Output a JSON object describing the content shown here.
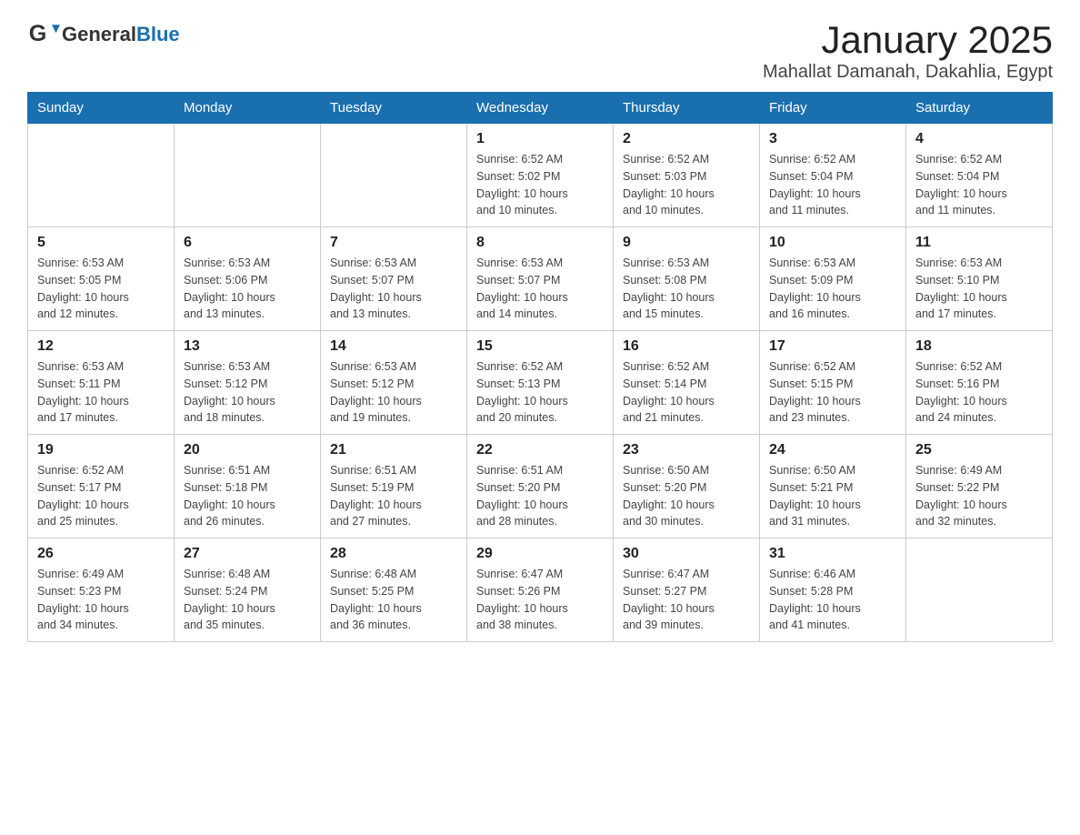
{
  "header": {
    "title": "January 2025",
    "subtitle": "Mahallat Damanah, Dakahlia, Egypt",
    "logo_general": "General",
    "logo_blue": "Blue"
  },
  "days_of_week": [
    "Sunday",
    "Monday",
    "Tuesday",
    "Wednesday",
    "Thursday",
    "Friday",
    "Saturday"
  ],
  "weeks": [
    [
      {
        "day": "",
        "info": ""
      },
      {
        "day": "",
        "info": ""
      },
      {
        "day": "",
        "info": ""
      },
      {
        "day": "1",
        "info": "Sunrise: 6:52 AM\nSunset: 5:02 PM\nDaylight: 10 hours\nand 10 minutes."
      },
      {
        "day": "2",
        "info": "Sunrise: 6:52 AM\nSunset: 5:03 PM\nDaylight: 10 hours\nand 10 minutes."
      },
      {
        "day": "3",
        "info": "Sunrise: 6:52 AM\nSunset: 5:04 PM\nDaylight: 10 hours\nand 11 minutes."
      },
      {
        "day": "4",
        "info": "Sunrise: 6:52 AM\nSunset: 5:04 PM\nDaylight: 10 hours\nand 11 minutes."
      }
    ],
    [
      {
        "day": "5",
        "info": "Sunrise: 6:53 AM\nSunset: 5:05 PM\nDaylight: 10 hours\nand 12 minutes."
      },
      {
        "day": "6",
        "info": "Sunrise: 6:53 AM\nSunset: 5:06 PM\nDaylight: 10 hours\nand 13 minutes."
      },
      {
        "day": "7",
        "info": "Sunrise: 6:53 AM\nSunset: 5:07 PM\nDaylight: 10 hours\nand 13 minutes."
      },
      {
        "day": "8",
        "info": "Sunrise: 6:53 AM\nSunset: 5:07 PM\nDaylight: 10 hours\nand 14 minutes."
      },
      {
        "day": "9",
        "info": "Sunrise: 6:53 AM\nSunset: 5:08 PM\nDaylight: 10 hours\nand 15 minutes."
      },
      {
        "day": "10",
        "info": "Sunrise: 6:53 AM\nSunset: 5:09 PM\nDaylight: 10 hours\nand 16 minutes."
      },
      {
        "day": "11",
        "info": "Sunrise: 6:53 AM\nSunset: 5:10 PM\nDaylight: 10 hours\nand 17 minutes."
      }
    ],
    [
      {
        "day": "12",
        "info": "Sunrise: 6:53 AM\nSunset: 5:11 PM\nDaylight: 10 hours\nand 17 minutes."
      },
      {
        "day": "13",
        "info": "Sunrise: 6:53 AM\nSunset: 5:12 PM\nDaylight: 10 hours\nand 18 minutes."
      },
      {
        "day": "14",
        "info": "Sunrise: 6:53 AM\nSunset: 5:12 PM\nDaylight: 10 hours\nand 19 minutes."
      },
      {
        "day": "15",
        "info": "Sunrise: 6:52 AM\nSunset: 5:13 PM\nDaylight: 10 hours\nand 20 minutes."
      },
      {
        "day": "16",
        "info": "Sunrise: 6:52 AM\nSunset: 5:14 PM\nDaylight: 10 hours\nand 21 minutes."
      },
      {
        "day": "17",
        "info": "Sunrise: 6:52 AM\nSunset: 5:15 PM\nDaylight: 10 hours\nand 23 minutes."
      },
      {
        "day": "18",
        "info": "Sunrise: 6:52 AM\nSunset: 5:16 PM\nDaylight: 10 hours\nand 24 minutes."
      }
    ],
    [
      {
        "day": "19",
        "info": "Sunrise: 6:52 AM\nSunset: 5:17 PM\nDaylight: 10 hours\nand 25 minutes."
      },
      {
        "day": "20",
        "info": "Sunrise: 6:51 AM\nSunset: 5:18 PM\nDaylight: 10 hours\nand 26 minutes."
      },
      {
        "day": "21",
        "info": "Sunrise: 6:51 AM\nSunset: 5:19 PM\nDaylight: 10 hours\nand 27 minutes."
      },
      {
        "day": "22",
        "info": "Sunrise: 6:51 AM\nSunset: 5:20 PM\nDaylight: 10 hours\nand 28 minutes."
      },
      {
        "day": "23",
        "info": "Sunrise: 6:50 AM\nSunset: 5:20 PM\nDaylight: 10 hours\nand 30 minutes."
      },
      {
        "day": "24",
        "info": "Sunrise: 6:50 AM\nSunset: 5:21 PM\nDaylight: 10 hours\nand 31 minutes."
      },
      {
        "day": "25",
        "info": "Sunrise: 6:49 AM\nSunset: 5:22 PM\nDaylight: 10 hours\nand 32 minutes."
      }
    ],
    [
      {
        "day": "26",
        "info": "Sunrise: 6:49 AM\nSunset: 5:23 PM\nDaylight: 10 hours\nand 34 minutes."
      },
      {
        "day": "27",
        "info": "Sunrise: 6:48 AM\nSunset: 5:24 PM\nDaylight: 10 hours\nand 35 minutes."
      },
      {
        "day": "28",
        "info": "Sunrise: 6:48 AM\nSunset: 5:25 PM\nDaylight: 10 hours\nand 36 minutes."
      },
      {
        "day": "29",
        "info": "Sunrise: 6:47 AM\nSunset: 5:26 PM\nDaylight: 10 hours\nand 38 minutes."
      },
      {
        "day": "30",
        "info": "Sunrise: 6:47 AM\nSunset: 5:27 PM\nDaylight: 10 hours\nand 39 minutes."
      },
      {
        "day": "31",
        "info": "Sunrise: 6:46 AM\nSunset: 5:28 PM\nDaylight: 10 hours\nand 41 minutes."
      },
      {
        "day": "",
        "info": ""
      }
    ]
  ]
}
